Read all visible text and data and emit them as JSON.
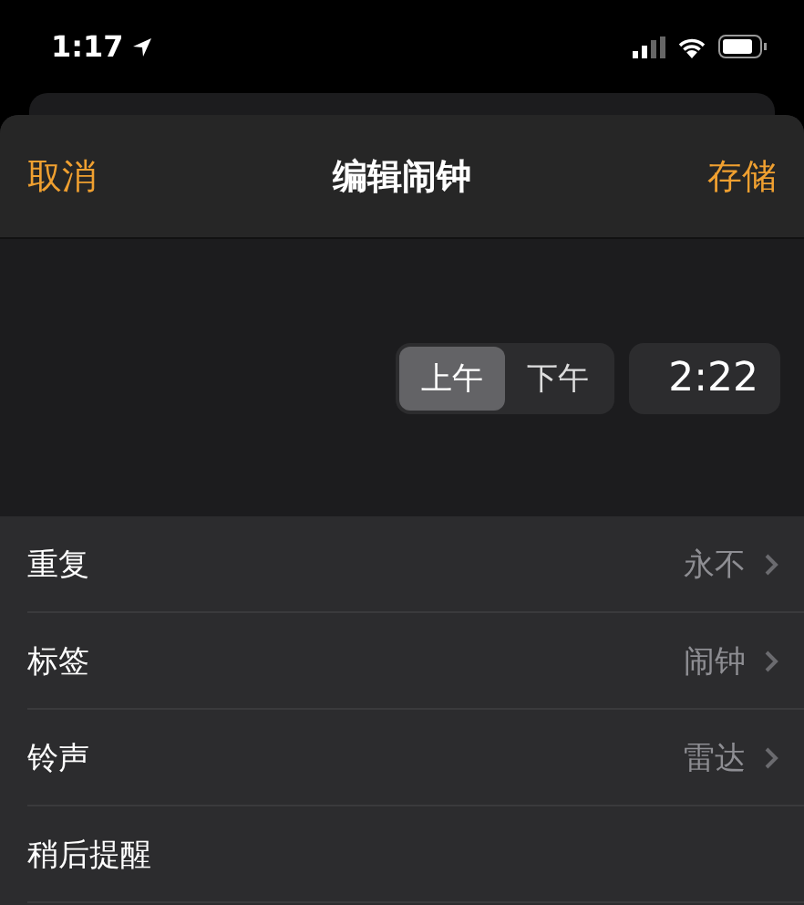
{
  "status_bar": {
    "time": "1:17"
  },
  "header": {
    "cancel": "取消",
    "title": "编辑闹钟",
    "save": "存储"
  },
  "picker": {
    "meridiem": [
      {
        "label": "上午",
        "selected": true
      },
      {
        "label": "下午",
        "selected": false
      }
    ],
    "time": "2:22"
  },
  "settings": [
    {
      "label": "重复",
      "value": "永不"
    },
    {
      "label": "标签",
      "value": "闹钟"
    },
    {
      "label": "铃声",
      "value": "雷达"
    },
    {
      "label": "稍后提醒"
    }
  ]
}
